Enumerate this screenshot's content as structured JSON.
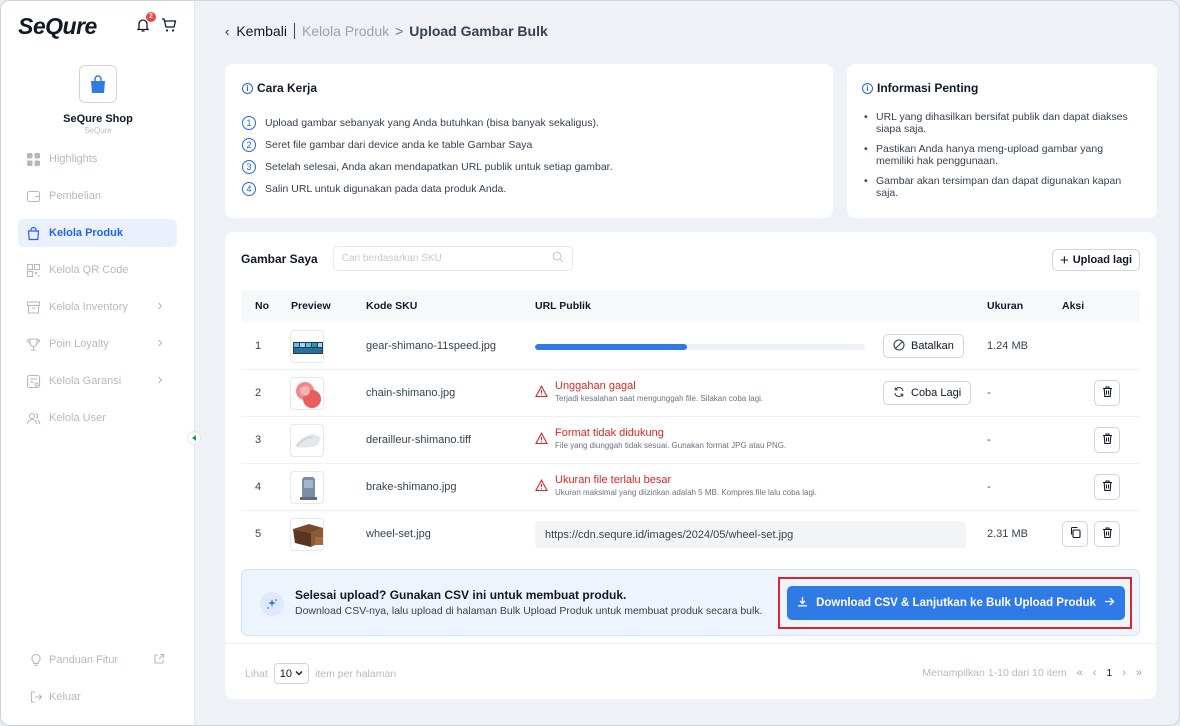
{
  "app": {
    "brand": "SeQure",
    "notification_count": "2"
  },
  "sidebar": {
    "shop_name": "SeQure Shop",
    "shop_sub": "SeQure",
    "items": [
      {
        "label": "Highlights",
        "icon": "grid-icon",
        "active": false,
        "chevron": false
      },
      {
        "label": "Pembelian",
        "icon": "wallet-icon",
        "active": false,
        "chevron": false
      },
      {
        "label": "Kelola Produk",
        "icon": "bag-icon",
        "active": true,
        "chevron": false
      },
      {
        "label": "Kelola QR Code",
        "icon": "qr-code-icon",
        "active": false,
        "chevron": false
      },
      {
        "label": "Kelola Inventory",
        "icon": "archive-icon",
        "active": false,
        "chevron": true
      },
      {
        "label": "Poin Loyalty",
        "icon": "trophy-icon",
        "active": false,
        "chevron": true
      },
      {
        "label": "Kelola Garansi",
        "icon": "warranty-icon",
        "active": false,
        "chevron": true
      },
      {
        "label": "Kelola User",
        "icon": "users-icon",
        "active": false,
        "chevron": false
      }
    ],
    "guide": "Panduan Fitur",
    "logout": "Keluar"
  },
  "breadcrumb": {
    "back": "Kembali",
    "parent": "Kelola Produk",
    "separator": ">",
    "current": "Upload Gambar Bulk"
  },
  "how_it_works": {
    "title": "Cara Kerja",
    "steps": [
      {
        "n": "1",
        "text": "Upload gambar sebanyak yang Anda butuhkan (bisa banyak sekaligus)."
      },
      {
        "n": "2",
        "text": "Seret file gambar dari device anda ke table Gambar Saya"
      },
      {
        "n": "3",
        "text": "Setelah selesai, Anda akan mendapatkan URL publik untuk setiap gambar."
      },
      {
        "n": "4",
        "text": "Salin URL untuk digunakan pada data produk Anda."
      }
    ]
  },
  "important": {
    "title": "Informasi Penting",
    "bullets": [
      "URL yang dihasilkan bersifat publik dan dapat diakses siapa saja.",
      "Pastikan Anda hanya meng-upload gambar yang memiliki hak penggunaan.",
      "Gambar akan tersimpan dan dapat digunakan kapan saja."
    ]
  },
  "gallery": {
    "title": "Gambar Saya",
    "search_placeholder": "Cari berdasarkan SKU",
    "upload_more": "Upload lagi",
    "columns": {
      "no": "No",
      "preview": "Preview",
      "sku": "Kode SKU",
      "url": "URL Publik",
      "size": "Ukuran",
      "action": "Aksi"
    },
    "rows": [
      {
        "no": "1",
        "sku": "gear-shimano-11speed.jpg",
        "status": "uploading",
        "progress": 0.46,
        "action_label": "Batalkan",
        "size": "1.24 MB"
      },
      {
        "no": "2",
        "sku": "chain-shimano.jpg",
        "status": "error",
        "error_title": "Unggahan gagal",
        "error_desc": "Terjadi kesalahan saat mengunggah file. Silakan coba lagi.",
        "action_label": "Coba Lagi",
        "size": "-"
      },
      {
        "no": "3",
        "sku": "derailleur-shimano.tiff",
        "status": "error",
        "error_title": "Format tidak didukung",
        "error_desc": "File yang diunggah tidak sesuai. Gunakan format JPG atau PNG.",
        "size": "-"
      },
      {
        "no": "4",
        "sku": "brake-shimano.jpg",
        "status": "error",
        "error_title": "Ukuran file terlalu besar",
        "error_desc": "Ukuran maksimal yang diizinkan adalah 5 MB. Kompres file lalu coba lagi.",
        "size": "-"
      },
      {
        "no": "5",
        "sku": "wheel-set.jpg",
        "status": "done",
        "url": "https://cdn.sequre.id/images/2024/05/wheel-set.jpg",
        "size": "2.31 MB"
      }
    ]
  },
  "banner": {
    "title": "Selesai upload? Gunakan CSV ini untuk membuat produk.",
    "desc": "Download CSV-nya, lalu upload di halaman Bulk Upload Produk untuk membuat produk secara bulk.",
    "cta": "Download CSV & Lanjutkan ke Bulk Upload Produk"
  },
  "pagination": {
    "see": "Lihat",
    "per_page": "10",
    "per_page_suffix": "item per halaman",
    "summary": "Menampilkan 1-10 dari 10 item",
    "page": "1",
    "first": "«",
    "prev": "‹",
    "next": "›",
    "last": "»"
  },
  "colors": {
    "accent": "#2f7ae5",
    "danger": "#dc2626",
    "active_bg": "#eaf1fd"
  }
}
